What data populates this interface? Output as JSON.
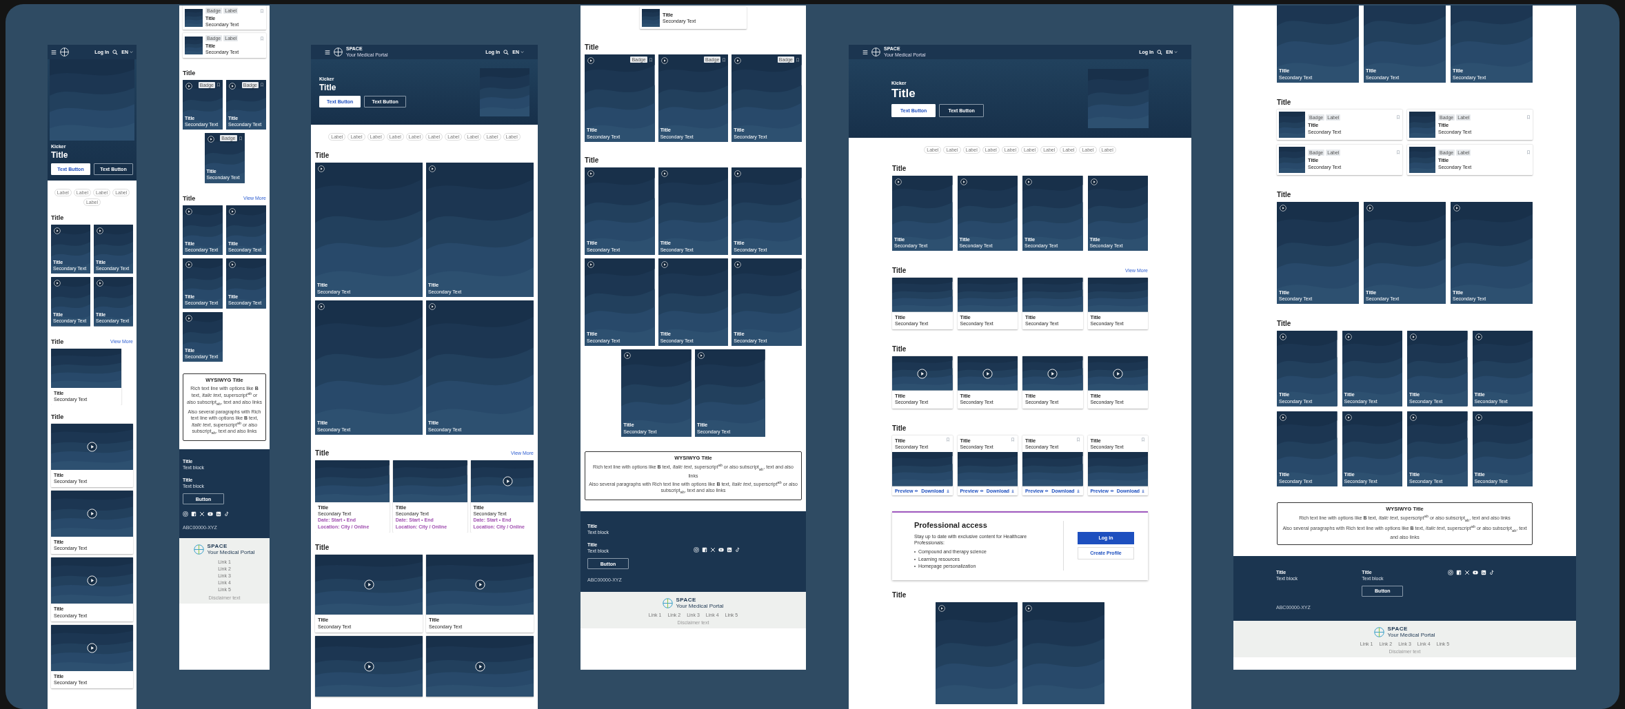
{
  "frames": [
    {
      "sections": [
        {
          "kind": "header",
          "login": "Log In",
          "language": "EN"
        },
        {
          "kind": "hero",
          "kicker": "Kicker",
          "title": "Title",
          "buttons": [
            {
              "label": "Text Button",
              "primary": true
            },
            {
              "label": "Text Button",
              "primary": false
            }
          ]
        },
        {
          "kind": "chips",
          "labels": [
            "Label",
            "Label",
            "Label",
            "Label",
            "Label"
          ]
        },
        {
          "kind": "grid",
          "title": "Title",
          "rows": [
            [
              {
                "kind": "tile",
                "title": "Title",
                "secondary": "Secondary Text"
              },
              {
                "kind": "tile",
                "title": "Title",
                "secondary": "Secondary Text"
              }
            ],
            [
              {
                "kind": "tile",
                "title": "Title",
                "secondary": "Secondary Text"
              },
              {
                "kind": "tile",
                "title": "Title",
                "secondary": "Secondary Text"
              }
            ]
          ]
        },
        {
          "kind": "carousel",
          "title": "Title",
          "view_more": "View More",
          "cards": [
            {
              "kind": "media",
              "play": false,
              "title": "Title",
              "secondary": "Secondary Text"
            }
          ]
        },
        {
          "kind": "grid",
          "title": "Title",
          "rows": [
            [
              {
                "kind": "media",
                "play": true,
                "title": "Title",
                "secondary": "Secondary Text"
              }
            ],
            [
              {
                "kind": "media",
                "play": true,
                "title": "Title",
                "secondary": "Secondary Text"
              }
            ],
            [
              {
                "kind": "media",
                "play": true,
                "title": "Title",
                "secondary": "Secondary Text"
              }
            ],
            [
              {
                "kind": "media",
                "play": true,
                "title": "Title",
                "secondary": "Secondary Text"
              }
            ]
          ]
        }
      ]
    },
    {
      "sections": [
        {
          "kind": "grid",
          "rows": [
            [
              {
                "kind": "compact",
                "badges": [
                  "Badge",
                  "Label"
                ],
                "title": "Title",
                "secondary": "Secondary Text"
              }
            ],
            [
              {
                "kind": "compact",
                "badges": [
                  "Badge",
                  "Label"
                ],
                "title": "Title",
                "secondary": "Secondary Text"
              }
            ]
          ]
        },
        {
          "kind": "grid",
          "title": "Title",
          "centered": true,
          "rows": [
            [
              {
                "kind": "tile",
                "badge": "Badge",
                "title": "Title",
                "secondary": "Secondary Text"
              },
              {
                "kind": "tile",
                "badge": "Badge",
                "title": "Title",
                "secondary": "Secondary Text"
              }
            ],
            [
              {
                "kind": "tile",
                "badge": "Badge",
                "title": "Title",
                "secondary": "Secondary Text"
              }
            ]
          ]
        },
        {
          "kind": "grid",
          "title": "Title",
          "view_more": "View More",
          "centered": false,
          "rows": [
            [
              {
                "kind": "tile",
                "title": "Title",
                "secondary": "Secondary Text"
              },
              {
                "kind": "tile",
                "title": "Title",
                "secondary": "Secondary Text"
              }
            ],
            [
              {
                "kind": "tile",
                "title": "Title",
                "secondary": "Secondary Text"
              },
              {
                "kind": "tile",
                "title": "Title",
                "secondary": "Secondary Text"
              }
            ],
            [
              {
                "kind": "tile",
                "title": "Title",
                "secondary": "Secondary Text"
              }
            ]
          ]
        },
        {
          "kind": "wysiwyg",
          "title": "WYSIWYG Title",
          "paragraphs": [
            "Rich text line with options like **B** text, *Italic text*, superscript$^{ab}$ or also subscript$_{ab}$, text and also links",
            "Also several paragraphs with Rich text line with options like **B** text, *Italic text*, superscript$^{ab}$ or also subscript$_{ab}$, text and also links"
          ]
        },
        {
          "kind": "footer",
          "blocks": [
            {
              "title": "Title",
              "text": "Text block"
            },
            {
              "title": "Title",
              "text": "Text block"
            }
          ],
          "button": "Button",
          "code": "ABC00000-XYZ"
        },
        {
          "kind": "bottom_footer",
          "brand": {
            "name": "SPACE",
            "tagline": "Your Medical Portal"
          },
          "links": [
            "Link 1",
            "Link 2",
            "Link 3",
            "Link 4",
            "Link 5"
          ],
          "disclaimer": "Disclaimer text"
        }
      ]
    },
    {
      "sections": [
        {
          "kind": "header",
          "brand": {
            "name": "SPACE",
            "tagline": "Your Medical Portal"
          },
          "login": "Log In",
          "language": "EN"
        },
        {
          "kind": "hero",
          "kicker": "Kicker",
          "title": "Title",
          "buttons": [
            {
              "label": "Text Button",
              "primary": true
            },
            {
              "label": "Text Button",
              "primary": false
            }
          ]
        },
        {
          "kind": "chips",
          "labels": [
            "Label",
            "Label",
            "Label",
            "Label",
            "Label",
            "Label",
            "Label",
            "Label",
            "Label",
            "Label"
          ]
        },
        {
          "kind": "grid",
          "title": "Title",
          "rows": [
            [
              {
                "kind": "tile",
                "title": "Title",
                "secondary": "Secondary Text"
              },
              {
                "kind": "tile",
                "title": "Title",
                "secondary": "Secondary Text"
              }
            ],
            [
              {
                "kind": "tile",
                "title": "Title",
                "secondary": "Secondary Text"
              },
              {
                "kind": "tile",
                "title": "Title",
                "secondary": "Secondary Text"
              }
            ]
          ]
        },
        {
          "kind": "carousel",
          "title": "Title",
          "view_more": "View More",
          "cards": [
            {
              "kind": "media",
              "play": false,
              "title": "Title",
              "secondary": "Secondary Text",
              "date": "Date: Start • End",
              "location": "Location: City / Online"
            },
            {
              "kind": "media",
              "play": false,
              "title": "Title",
              "secondary": "Secondary Text",
              "date": "Date: Start • End",
              "location": "Location: City / Online"
            },
            {
              "kind": "media",
              "play": true,
              "title": "Title",
              "secondary": "Secondary Text",
              "date": "Date: Start • End",
              "location": "Location: City / Online"
            }
          ]
        },
        {
          "kind": "grid",
          "title": "Title",
          "rows": [
            [
              {
                "kind": "media",
                "play": true,
                "title": "Title",
                "secondary": "Secondary Text"
              },
              {
                "kind": "media",
                "play": true,
                "title": "Title",
                "secondary": "Secondary Text"
              }
            ],
            [
              {
                "kind": "media",
                "play": true
              },
              {
                "kind": "media",
                "play": true
              }
            ]
          ]
        }
      ]
    },
    {
      "sections": [
        {
          "kind": "grid",
          "centered": true,
          "rows": [
            [
              {
                "kind": "compact",
                "title": "Title",
                "secondary": "Secondary Text"
              }
            ]
          ]
        },
        {
          "kind": "grid",
          "title": "Title",
          "centered": false,
          "rows": [
            [
              {
                "kind": "tile",
                "badge": "Badge",
                "title": "Title",
                "secondary": "Secondary Text"
              },
              {
                "kind": "tile",
                "badge": "Badge",
                "title": "Title",
                "secondary": "Secondary Text"
              },
              {
                "kind": "tile",
                "badge": "Badge",
                "title": "Title",
                "secondary": "Secondary Text"
              }
            ]
          ]
        },
        {
          "kind": "grid",
          "title": "Title",
          "centered": true,
          "rows": [
            [
              {
                "kind": "tile",
                "title": "Title",
                "secondary": "Secondary Text"
              },
              {
                "kind": "tile",
                "title": "Title",
                "secondary": "Secondary Text"
              },
              {
                "kind": "tile",
                "title": "Title",
                "secondary": "Secondary Text"
              }
            ],
            [
              {
                "kind": "tile",
                "title": "Title",
                "secondary": "Secondary Text"
              },
              {
                "kind": "tile",
                "title": "Title",
                "secondary": "Secondary Text"
              },
              {
                "kind": "tile",
                "title": "Title",
                "secondary": "Secondary Text"
              }
            ],
            [
              {
                "kind": "tile",
                "title": "Title",
                "secondary": "Secondary Text"
              },
              {
                "kind": "tile",
                "title": "Title",
                "secondary": "Secondary Text"
              }
            ]
          ]
        },
        {
          "kind": "wysiwyg",
          "title": "WYSIWYG Title",
          "paragraphs": [
            "Rich text line with options like **B** text, *Italic text*, superscript$^{ab}$ or also subscript$_{ab}$, text and also links",
            "Also several paragraphs with Rich text line with options like **B** text, *Italic text*, superscript$^{ab}$ or also subscript$_{ab}$, text and also links"
          ]
        },
        {
          "kind": "footer",
          "blocks": [
            {
              "title": "Title",
              "text": "Text block"
            },
            {
              "title": "Title",
              "text": "Text block"
            }
          ],
          "button": "Button",
          "code": "ABC00000-XYZ"
        },
        {
          "kind": "bottom_footer",
          "brand": {
            "name": "SPACE",
            "tagline": "Your Medical Portal"
          },
          "links": [
            "Link 1",
            "Link 2",
            "Link 3",
            "Link 4",
            "Link 5"
          ],
          "disclaimer": "Disclaimer text"
        }
      ]
    },
    {
      "sections": [
        {
          "kind": "header",
          "brand": {
            "name": "SPACE",
            "tagline": "Your Medical Portal"
          },
          "login": "Log In",
          "language": "EN"
        },
        {
          "kind": "hero",
          "kicker": "Kicker",
          "title": "Title",
          "buttons": [
            {
              "label": "Text Button",
              "primary": true
            },
            {
              "label": "Text Button",
              "primary": false
            }
          ]
        },
        {
          "kind": "chips",
          "labels": [
            "Label",
            "Label",
            "Label",
            "Label",
            "Label",
            "Label",
            "Label",
            "Label",
            "Label",
            "Label"
          ]
        },
        {
          "kind": "grid",
          "title": "Title",
          "centered": false,
          "rows": [
            [
              {
                "kind": "tile",
                "title": "Title",
                "secondary": "Secondary Text"
              },
              {
                "kind": "tile",
                "title": "Title",
                "secondary": "Secondary Text"
              },
              {
                "kind": "tile",
                "title": "Title",
                "secondary": "Secondary Text"
              },
              {
                "kind": "tile",
                "title": "Title",
                "secondary": "Secondary Text"
              }
            ]
          ]
        },
        {
          "kind": "grid",
          "title": "Title",
          "view_more": "View More",
          "centered": false,
          "rows": [
            [
              {
                "kind": "media",
                "play": false,
                "title": "Title",
                "secondary": "Secondary Text"
              },
              {
                "kind": "media",
                "play": false,
                "title": "Title",
                "secondary": "Secondary Text"
              },
              {
                "kind": "media",
                "play": false,
                "title": "Title",
                "secondary": "Secondary Text"
              },
              {
                "kind": "media",
                "play": false,
                "title": "Title",
                "secondary": "Secondary Text"
              }
            ]
          ]
        },
        {
          "kind": "grid",
          "title": "Title",
          "centered": false,
          "rows": [
            [
              {
                "kind": "media",
                "play": true,
                "title": "Title",
                "secondary": "Secondary Text"
              },
              {
                "kind": "media",
                "play": true,
                "title": "Title",
                "secondary": "Secondary Text"
              },
              {
                "kind": "media",
                "play": true,
                "title": "Title",
                "secondary": "Secondary Text"
              },
              {
                "kind": "media",
                "play": true,
                "title": "Title",
                "secondary": "Secondary Text"
              }
            ]
          ]
        },
        {
          "kind": "grid",
          "title": "Title",
          "centered": false,
          "rows": [
            [
              {
                "kind": "document",
                "title": "Title",
                "secondary": "Secondary Text",
                "preview": "Preview",
                "download": "Download"
              },
              {
                "kind": "document",
                "title": "Title",
                "secondary": "Secondary Text",
                "preview": "Preview",
                "download": "Download"
              },
              {
                "kind": "document",
                "title": "Title",
                "secondary": "Secondary Text",
                "preview": "Preview",
                "download": "Download"
              },
              {
                "kind": "document",
                "title": "Title",
                "secondary": "Secondary Text",
                "preview": "Preview",
                "download": "Download"
              }
            ]
          ]
        },
        {
          "kind": "access",
          "title": "Professional access",
          "text": "Stay up to date with exclusive content for Healthcare Professionals:",
          "items": [
            "Compound and therapy science",
            "Learning resources",
            "Homepage personalization"
          ],
          "login": "Log in",
          "create": "Create Profile"
        },
        {
          "kind": "grid",
          "title": "Title",
          "centered": true,
          "rows": [
            [
              {
                "kind": "tile"
              },
              {
                "kind": "tile"
              }
            ]
          ]
        }
      ]
    },
    {
      "sections": [
        {
          "kind": "grid",
          "centered": false,
          "rows": [
            [
              {
                "kind": "tile",
                "title": "Title",
                "secondary": "Secondary Text"
              },
              {
                "kind": "tile",
                "title": "Title",
                "secondary": "Secondary Text"
              },
              {
                "kind": "tile",
                "title": "Title",
                "secondary": "Secondary Text"
              }
            ]
          ]
        },
        {
          "kind": "grid",
          "title": "Title",
          "centered": false,
          "rows": [
            [
              {
                "kind": "compact",
                "badges": [
                  "Badge",
                  "Label"
                ],
                "title": "Title",
                "secondary": "Secondary Text"
              },
              {
                "kind": "compact",
                "badges": [
                  "Badge",
                  "Label"
                ],
                "title": "Title",
                "secondary": "Secondary Text"
              }
            ],
            [
              {
                "kind": "compact",
                "badges": [
                  "Badge",
                  "Label"
                ],
                "title": "Title",
                "secondary": "Secondary Text"
              },
              {
                "kind": "compact",
                "badges": [
                  "Badge",
                  "Label"
                ],
                "title": "Title",
                "secondary": "Secondary Text"
              }
            ]
          ]
        },
        {
          "kind": "grid",
          "title": "Title",
          "centered": false,
          "rows": [
            [
              {
                "kind": "tile",
                "title": "Title",
                "secondary": "Secondary Text"
              },
              {
                "kind": "tile",
                "title": "Title",
                "secondary": "Secondary Text"
              },
              {
                "kind": "tile",
                "title": "Title",
                "secondary": "Secondary Text"
              }
            ]
          ]
        },
        {
          "kind": "grid",
          "title": "Title",
          "centered": false,
          "rows": [
            [
              {
                "kind": "tile",
                "title": "Title",
                "secondary": "Secondary Text"
              },
              {
                "kind": "tile",
                "title": "Title",
                "secondary": "Secondary Text"
              },
              {
                "kind": "tile",
                "title": "Title",
                "secondary": "Secondary Text"
              },
              {
                "kind": "tile",
                "title": "Title",
                "secondary": "Secondary Text"
              }
            ],
            [
              {
                "kind": "tile",
                "title": "Title",
                "secondary": "Secondary Text"
              },
              {
                "kind": "tile",
                "title": "Title",
                "secondary": "Secondary Text"
              },
              {
                "kind": "tile",
                "title": "Title",
                "secondary": "Secondary Text"
              },
              {
                "kind": "tile",
                "title": "Title",
                "secondary": "Secondary Text"
              }
            ]
          ]
        },
        {
          "kind": "wysiwyg",
          "title": "WYSIWYG Title",
          "paragraphs": [
            "Rich text line with options like **B** text, *Italic text*, superscript$^{ab}$ or also subscript$_{ab}$, text and also links",
            "Also several paragraphs with Rich text line with options like **B** text, *Italic text*, superscript$^{ab}$ or also subscript$_{ab}$, text and also links"
          ]
        },
        {
          "kind": "footer",
          "blocks": [
            {
              "title": "Title",
              "text": "Text block"
            },
            {
              "title": "Title",
              "text": "Text block"
            }
          ],
          "button": "Button",
          "code": "ABC00000-XYZ"
        },
        {
          "kind": "bottom_footer",
          "brand": {
            "name": "SPACE",
            "tagline": "Your Medical Portal"
          },
          "links": [
            "Link 1",
            "Link 2",
            "Link 3",
            "Link 4",
            "Link 5"
          ],
          "disclaimer": "Disclaimer text"
        }
      ]
    }
  ]
}
